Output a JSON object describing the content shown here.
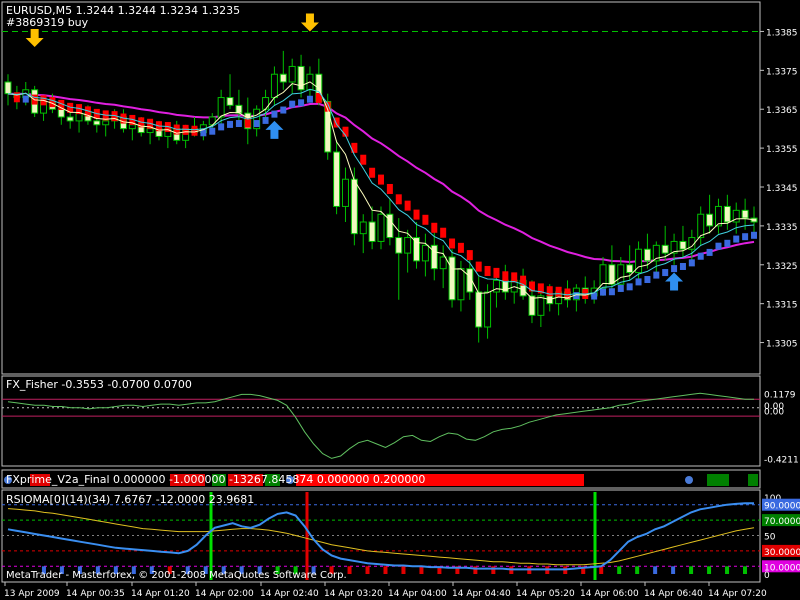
{
  "chart_data": {
    "type": "candlestick",
    "symbol_header": "EURUSD,M5  1.3244 1.3244 1.3234 1.3235",
    "order_label": "#3869319 buy",
    "y_ticks": [
      "1.3385",
      "1.3375",
      "1.3365",
      "1.3355",
      "1.3345",
      "1.3335",
      "1.3325",
      "1.3315",
      "1.3305"
    ],
    "ylim": [
      1.33,
      1.339
    ],
    "order_level": 1.3385,
    "x_ticks": [
      "13 Apr 2009",
      "14 Apr 00:35",
      "14 Apr 01:20",
      "14 Apr 02:00",
      "14 Apr 02:40",
      "14 Apr 03:20",
      "14 Apr 04:00",
      "14 Apr 04:40",
      "14 Apr 05:20",
      "14 Apr 06:00",
      "14 Apr 06:40",
      "14 Apr 07:20"
    ],
    "candles": [
      [
        1.3372,
        1.3374,
        1.3366,
        1.3369
      ],
      [
        1.3369,
        1.3371,
        1.3365,
        1.3368
      ],
      [
        1.3368,
        1.3372,
        1.3366,
        1.337
      ],
      [
        1.337,
        1.3371,
        1.3363,
        1.3364
      ],
      [
        1.3364,
        1.3368,
        1.3362,
        1.3367
      ],
      [
        1.3367,
        1.3369,
        1.3364,
        1.3365
      ],
      [
        1.3365,
        1.3367,
        1.3361,
        1.3363
      ],
      [
        1.3363,
        1.3366,
        1.336,
        1.3362
      ],
      [
        1.3362,
        1.3365,
        1.3359,
        1.3364
      ],
      [
        1.3364,
        1.3366,
        1.3361,
        1.3362
      ],
      [
        1.3362,
        1.3364,
        1.3359,
        1.3361
      ],
      [
        1.3361,
        1.3363,
        1.3358,
        1.3362
      ],
      [
        1.3362,
        1.3365,
        1.336,
        1.3363
      ],
      [
        1.3363,
        1.3365,
        1.3359,
        1.336
      ],
      [
        1.336,
        1.3363,
        1.3357,
        1.3361
      ],
      [
        1.3361,
        1.3363,
        1.3358,
        1.3359
      ],
      [
        1.3359,
        1.3362,
        1.3356,
        1.336
      ],
      [
        1.336,
        1.3362,
        1.3357,
        1.3358
      ],
      [
        1.3358,
        1.3361,
        1.3355,
        1.336
      ],
      [
        1.336,
        1.3362,
        1.3356,
        1.3357
      ],
      [
        1.3357,
        1.3361,
        1.3355,
        1.336
      ],
      [
        1.336,
        1.3363,
        1.3358,
        1.3359
      ],
      [
        1.3359,
        1.3362,
        1.3357,
        1.3361
      ],
      [
        1.3361,
        1.3364,
        1.3359,
        1.3363
      ],
      [
        1.3363,
        1.337,
        1.3361,
        1.3368
      ],
      [
        1.3368,
        1.3374,
        1.3365,
        1.3366
      ],
      [
        1.3366,
        1.337,
        1.3362,
        1.3364
      ],
      [
        1.3364,
        1.3368,
        1.3356,
        1.336
      ],
      [
        1.336,
        1.3366,
        1.3358,
        1.3365
      ],
      [
        1.3365,
        1.337,
        1.3362,
        1.3368
      ],
      [
        1.3368,
        1.3376,
        1.3366,
        1.3374
      ],
      [
        1.3374,
        1.338,
        1.337,
        1.3372
      ],
      [
        1.3372,
        1.3378,
        1.3369,
        1.3376
      ],
      [
        1.3376,
        1.3379,
        1.3368,
        1.337
      ],
      [
        1.337,
        1.3376,
        1.3367,
        1.3374
      ],
      [
        1.3374,
        1.3378,
        1.3366,
        1.3367
      ],
      [
        1.3367,
        1.3369,
        1.3352,
        1.3354
      ],
      [
        1.3354,
        1.3357,
        1.3338,
        1.334
      ],
      [
        1.334,
        1.335,
        1.3336,
        1.3347
      ],
      [
        1.3347,
        1.335,
        1.333,
        1.3333
      ],
      [
        1.3333,
        1.3338,
        1.3328,
        1.3336
      ],
      [
        1.3336,
        1.334,
        1.3329,
        1.3331
      ],
      [
        1.3331,
        1.334,
        1.3329,
        1.3338
      ],
      [
        1.3338,
        1.3342,
        1.333,
        1.3332
      ],
      [
        1.3332,
        1.3337,
        1.3316,
        1.3328
      ],
      [
        1.3328,
        1.3334,
        1.3323,
        1.3332
      ],
      [
        1.3332,
        1.3336,
        1.3324,
        1.3326
      ],
      [
        1.3326,
        1.3333,
        1.3322,
        1.333
      ],
      [
        1.333,
        1.3334,
        1.3321,
        1.3324
      ],
      [
        1.3324,
        1.333,
        1.3319,
        1.3327
      ],
      [
        1.3327,
        1.3329,
        1.3314,
        1.3316
      ],
      [
        1.3316,
        1.3326,
        1.3313,
        1.3324
      ],
      [
        1.3324,
        1.3327,
        1.3316,
        1.3318
      ],
      [
        1.3318,
        1.3322,
        1.3305,
        1.3309
      ],
      [
        1.3309,
        1.332,
        1.3306,
        1.3318
      ],
      [
        1.3318,
        1.3324,
        1.3314,
        1.3321
      ],
      [
        1.3321,
        1.3325,
        1.3316,
        1.3318
      ],
      [
        1.3318,
        1.3323,
        1.3315,
        1.3321
      ],
      [
        1.3321,
        1.3324,
        1.3316,
        1.3317
      ],
      [
        1.3317,
        1.3321,
        1.331,
        1.3312
      ],
      [
        1.3312,
        1.3319,
        1.3309,
        1.3317
      ],
      [
        1.3317,
        1.332,
        1.3313,
        1.3315
      ],
      [
        1.3315,
        1.3319,
        1.3312,
        1.3318
      ],
      [
        1.3318,
        1.3321,
        1.3314,
        1.3316
      ],
      [
        1.3316,
        1.332,
        1.3313,
        1.3319
      ],
      [
        1.3319,
        1.3322,
        1.3315,
        1.3317
      ],
      [
        1.3317,
        1.3321,
        1.3315,
        1.3319
      ],
      [
        1.3319,
        1.3327,
        1.3317,
        1.3325
      ],
      [
        1.3325,
        1.333,
        1.3318,
        1.332
      ],
      [
        1.332,
        1.3327,
        1.3318,
        1.3325
      ],
      [
        1.3325,
        1.333,
        1.3321,
        1.3323
      ],
      [
        1.3323,
        1.3331,
        1.3321,
        1.3329
      ],
      [
        1.3329,
        1.3333,
        1.3324,
        1.3326
      ],
      [
        1.3326,
        1.3331,
        1.3323,
        1.333
      ],
      [
        1.333,
        1.3335,
        1.3326,
        1.3328
      ],
      [
        1.3328,
        1.3333,
        1.3325,
        1.3331
      ],
      [
        1.3331,
        1.3335,
        1.3327,
        1.3329
      ],
      [
        1.3329,
        1.3334,
        1.3326,
        1.3332
      ],
      [
        1.3332,
        1.334,
        1.333,
        1.3338
      ],
      [
        1.3338,
        1.3343,
        1.3333,
        1.3335
      ],
      [
        1.3335,
        1.3342,
        1.3333,
        1.334
      ],
      [
        1.334,
        1.3343,
        1.3334,
        1.3336
      ],
      [
        1.3336,
        1.3341,
        1.3333,
        1.3339
      ],
      [
        1.3339,
        1.3342,
        1.3334,
        1.3337
      ],
      [
        1.3337,
        1.334,
        1.3333,
        1.3336
      ]
    ],
    "fisher": {
      "label": "FX_Fisher -0.3553 -0.0700 0.0700",
      "ticks": [
        "0.1179",
        "0.00",
        "0.00",
        "-0.4211"
      ],
      "levels": [
        0.07,
        -0.07
      ],
      "ylim": [
        -0.45,
        0.13
      ],
      "values": [
        0.05,
        0.04,
        0.03,
        0.02,
        0.02,
        0.01,
        0.01,
        0.0,
        0.0,
        -0.01,
        0.0,
        0.0,
        0.01,
        0.02,
        0.02,
        0.01,
        0.02,
        0.03,
        0.03,
        0.02,
        0.03,
        0.04,
        0.04,
        0.05,
        0.07,
        0.09,
        0.11,
        0.11,
        0.1,
        0.08,
        0.06,
        0.02,
        -0.08,
        -0.2,
        -0.3,
        -0.38,
        -0.42,
        -0.4,
        -0.34,
        -0.29,
        -0.27,
        -0.3,
        -0.33,
        -0.29,
        -0.24,
        -0.23,
        -0.27,
        -0.28,
        -0.24,
        -0.21,
        -0.22,
        -0.26,
        -0.27,
        -0.24,
        -0.2,
        -0.18,
        -0.17,
        -0.15,
        -0.12,
        -0.1,
        -0.08,
        -0.06,
        -0.05,
        -0.04,
        -0.03,
        -0.02,
        -0.01,
        0.0,
        0.02,
        0.03,
        0.05,
        0.06,
        0.07,
        0.08,
        0.09,
        0.1,
        0.11,
        0.12,
        0.11,
        0.1,
        0.09,
        0.08,
        0.07,
        0.07
      ]
    },
    "xprime": {
      "label": "FXprime_V2a_Final 0.000000 -1.000000 -13267.845874 0.000000 0.200000"
    },
    "rsioma": {
      "label": "RSIOMA[0](14)(34) 7.6767 -12.0000 23.9681",
      "ticks": [
        "100",
        "90.0000",
        "70.0000",
        "50",
        "30.0000",
        "10.0000",
        "0"
      ],
      "levels": [
        90,
        70,
        30,
        10
      ],
      "ylim": [
        0,
        100
      ],
      "rsi": [
        58,
        56,
        54,
        52,
        50,
        48,
        46,
        44,
        42,
        40,
        38,
        36,
        34,
        33,
        32,
        31,
        30,
        29,
        28,
        27,
        30,
        38,
        50,
        60,
        63,
        66,
        62,
        60,
        64,
        72,
        78,
        80,
        76,
        62,
        45,
        32,
        24,
        20,
        18,
        16,
        14,
        13,
        12,
        11,
        11,
        10,
        10,
        9,
        9,
        8,
        8,
        8,
        7,
        7,
        7,
        7,
        6,
        6,
        6,
        6,
        6,
        6,
        6,
        7,
        8,
        9,
        10,
        18,
        30,
        42,
        48,
        52,
        58,
        62,
        68,
        74,
        80,
        84,
        86,
        88,
        90,
        91,
        92,
        92
      ],
      "ma": [
        85,
        84,
        83,
        82,
        80,
        79,
        77,
        75,
        73,
        71,
        69,
        67,
        65,
        63,
        61,
        59,
        58,
        57,
        56,
        55,
        55,
        55,
        55,
        56,
        57,
        58,
        59,
        59,
        58,
        57,
        55,
        53,
        50,
        47,
        44,
        41,
        38,
        36,
        34,
        32,
        30,
        29,
        28,
        27,
        26,
        25,
        24,
        23,
        22,
        21,
        20,
        19,
        18,
        17,
        16,
        16,
        15,
        14,
        14,
        13,
        13,
        12,
        12,
        12,
        12,
        13,
        14,
        15,
        17,
        20,
        23,
        26,
        29,
        32,
        35,
        38,
        41,
        44,
        47,
        50,
        53,
        56,
        58,
        60
      ]
    },
    "footer": "MetaTrader - Masterforex, © 2001-2008 MetaQuotes Software Corp."
  }
}
